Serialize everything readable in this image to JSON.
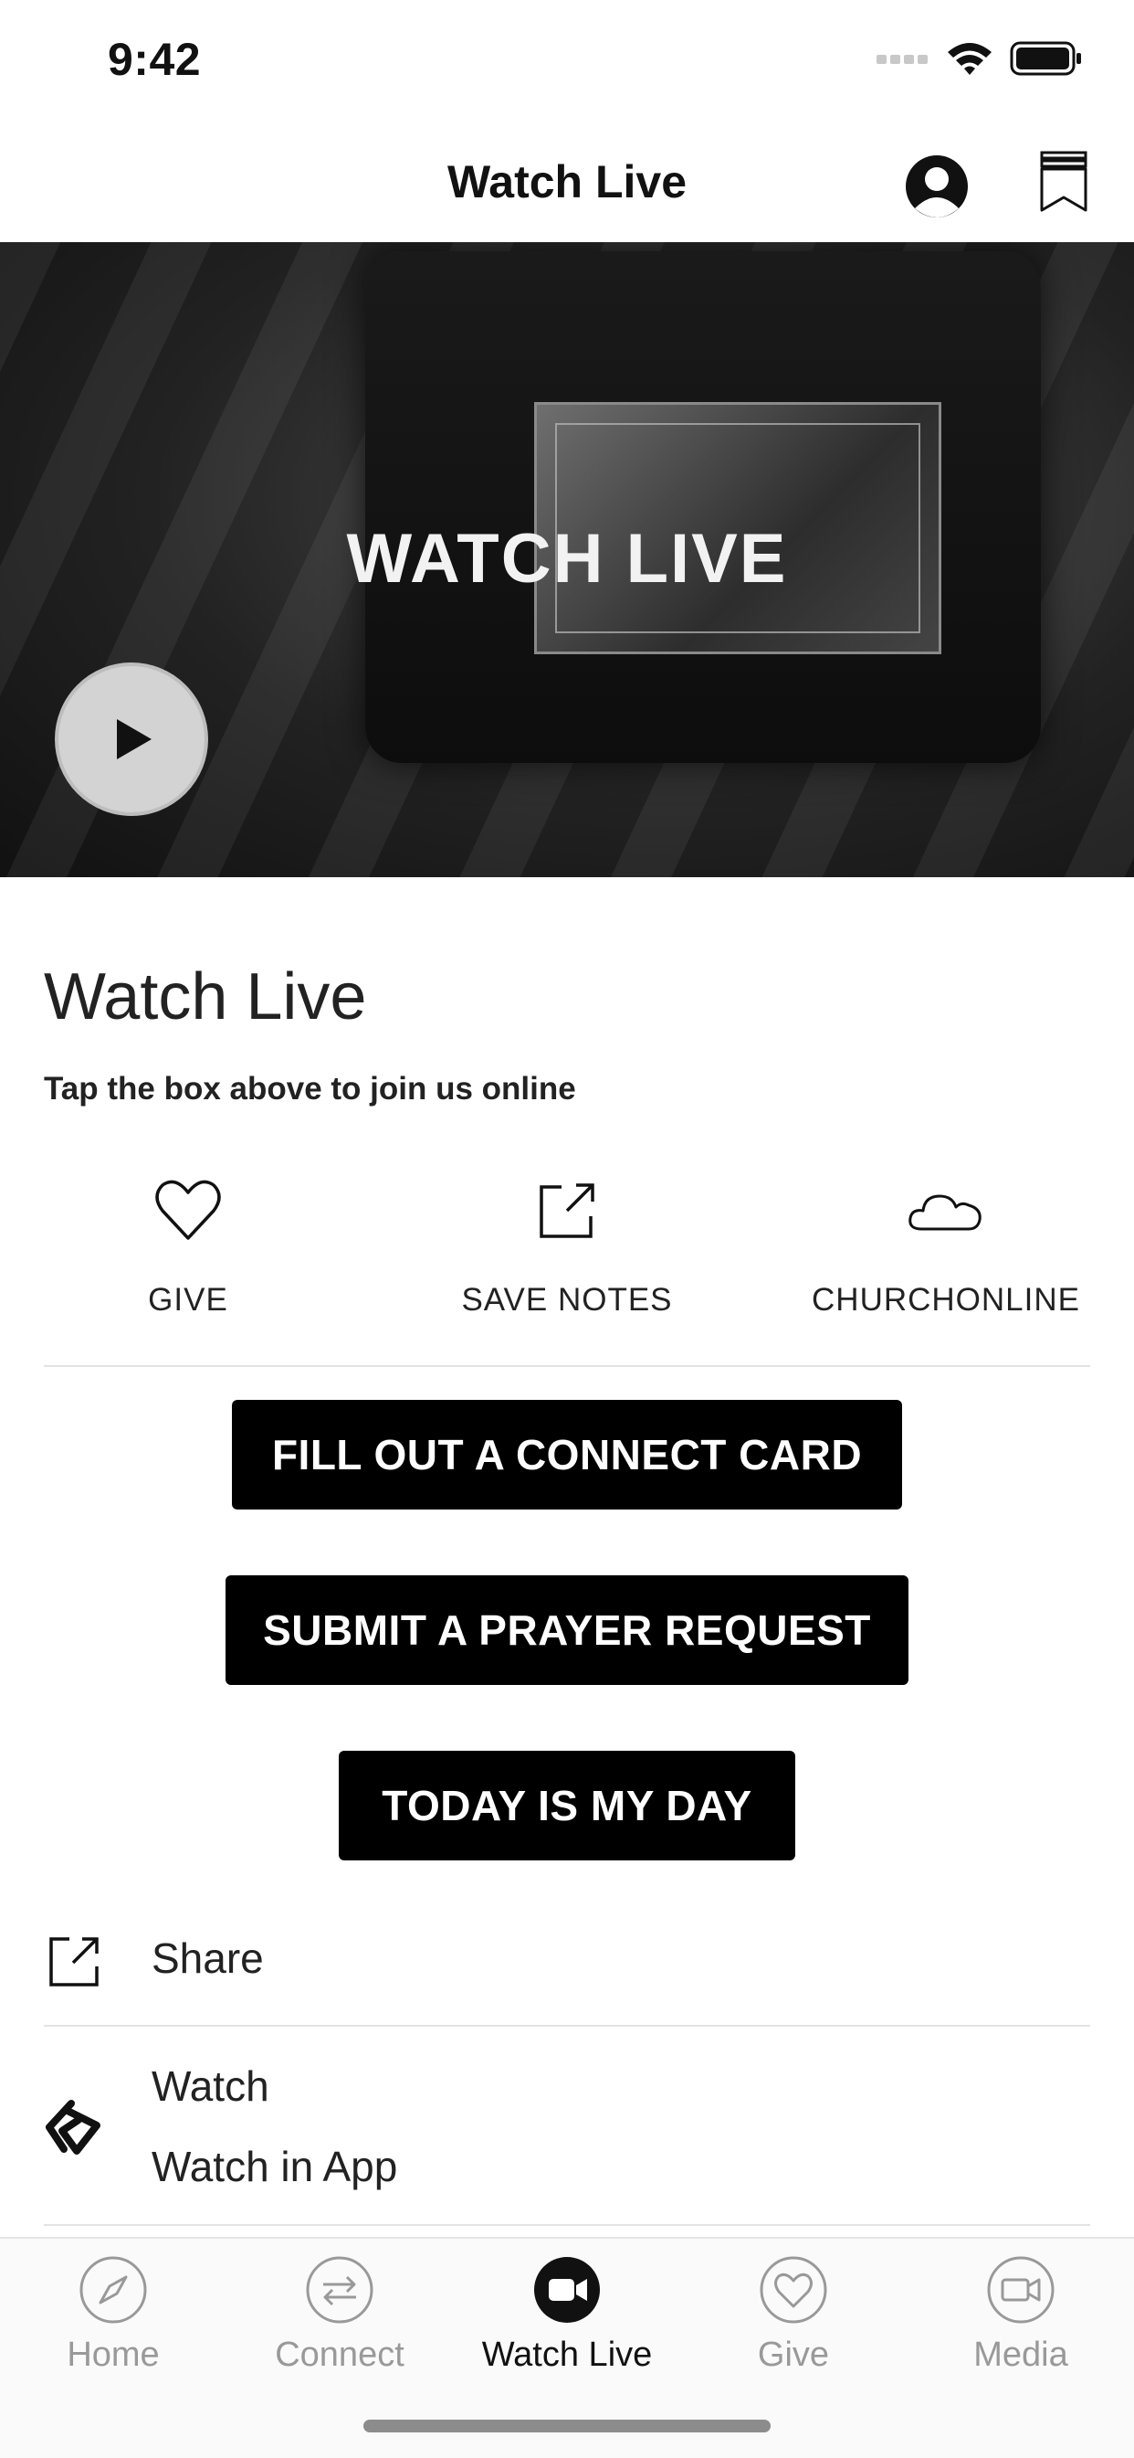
{
  "status_bar": {
    "time": "9:42"
  },
  "nav": {
    "title": "Watch Live",
    "profile_icon": "person-circle-icon",
    "bookmarks_icon": "bookmarks-icon"
  },
  "hero": {
    "title": "WATCH LIVE",
    "play_icon": "play-icon"
  },
  "content": {
    "title": "Watch Live",
    "subtitle": "Tap the box above to join us online"
  },
  "actions": [
    {
      "label": "GIVE",
      "icon": "heart-icon"
    },
    {
      "label": "SAVE NOTES",
      "icon": "external-link-icon"
    },
    {
      "label": "CHURCHONLINE",
      "icon": "cloud-icon"
    }
  ],
  "buttons": [
    "FILL OUT A CONNECT CARD",
    "SUBMIT A PRAYER REQUEST",
    "TODAY IS MY DAY"
  ],
  "list": {
    "share": {
      "label": "Share",
      "icon": "share-icon"
    },
    "watch": {
      "title": "Watch",
      "subtitle": "Watch in App",
      "icon": "watch-app-icon"
    }
  },
  "tabs": [
    {
      "label": "Home",
      "icon": "compass-icon",
      "active": false
    },
    {
      "label": "Connect",
      "icon": "arrows-exchange-icon",
      "active": false
    },
    {
      "label": "Watch Live",
      "icon": "video-camera-icon",
      "active": true
    },
    {
      "label": "Give",
      "icon": "heart-icon",
      "active": false
    },
    {
      "label": "Media",
      "icon": "video-icon",
      "active": false
    }
  ]
}
